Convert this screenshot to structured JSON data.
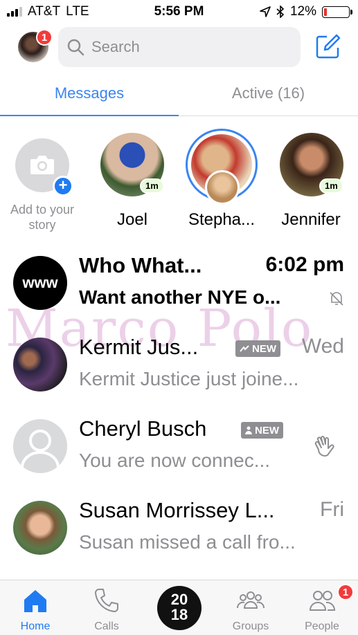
{
  "status_bar": {
    "carrier": "AT&T",
    "network": "LTE",
    "time": "5:56 PM",
    "battery": "12%",
    "battery_level": 0.12
  },
  "header": {
    "profile_badge": "1",
    "search_placeholder": "Search"
  },
  "tabs": {
    "messages": "Messages",
    "active": "Active (16)"
  },
  "stories": {
    "add_label": "Add to your story",
    "items": [
      {
        "name": "Joel",
        "time": "1m"
      },
      {
        "name": "Stepha...",
        "time": ""
      },
      {
        "name": "Jennifer",
        "time": "1m"
      }
    ]
  },
  "conversations": [
    {
      "name": "Who What...",
      "snippet": "Want another NYE o...",
      "time": "6:02 pm",
      "avatar_text": "www",
      "unread": true,
      "muted": true
    },
    {
      "name": "Kermit Jus...",
      "snippet": "Kermit Justice just joine...",
      "time": "Wed",
      "tag": "NEW"
    },
    {
      "name": "Cheryl Busch",
      "snippet": "You are now connec...",
      "time": "",
      "tag": "NEW"
    },
    {
      "name": "Susan Morrissey L...",
      "snippet": "Susan missed a call fro...",
      "time": "Fri"
    }
  ],
  "watermark": "Marco Polo",
  "tabbar": {
    "home": "Home",
    "calls": "Calls",
    "year_top": "20",
    "year_bottom": "18",
    "groups": "Groups",
    "people": "People",
    "people_badge": "1"
  },
  "colors": {
    "accent": "#3b84f0",
    "badge": "#f23b3b",
    "story_ring": "#3b84f0",
    "active_pill": "#e6fbd9",
    "battery_low": "#e8322a"
  }
}
